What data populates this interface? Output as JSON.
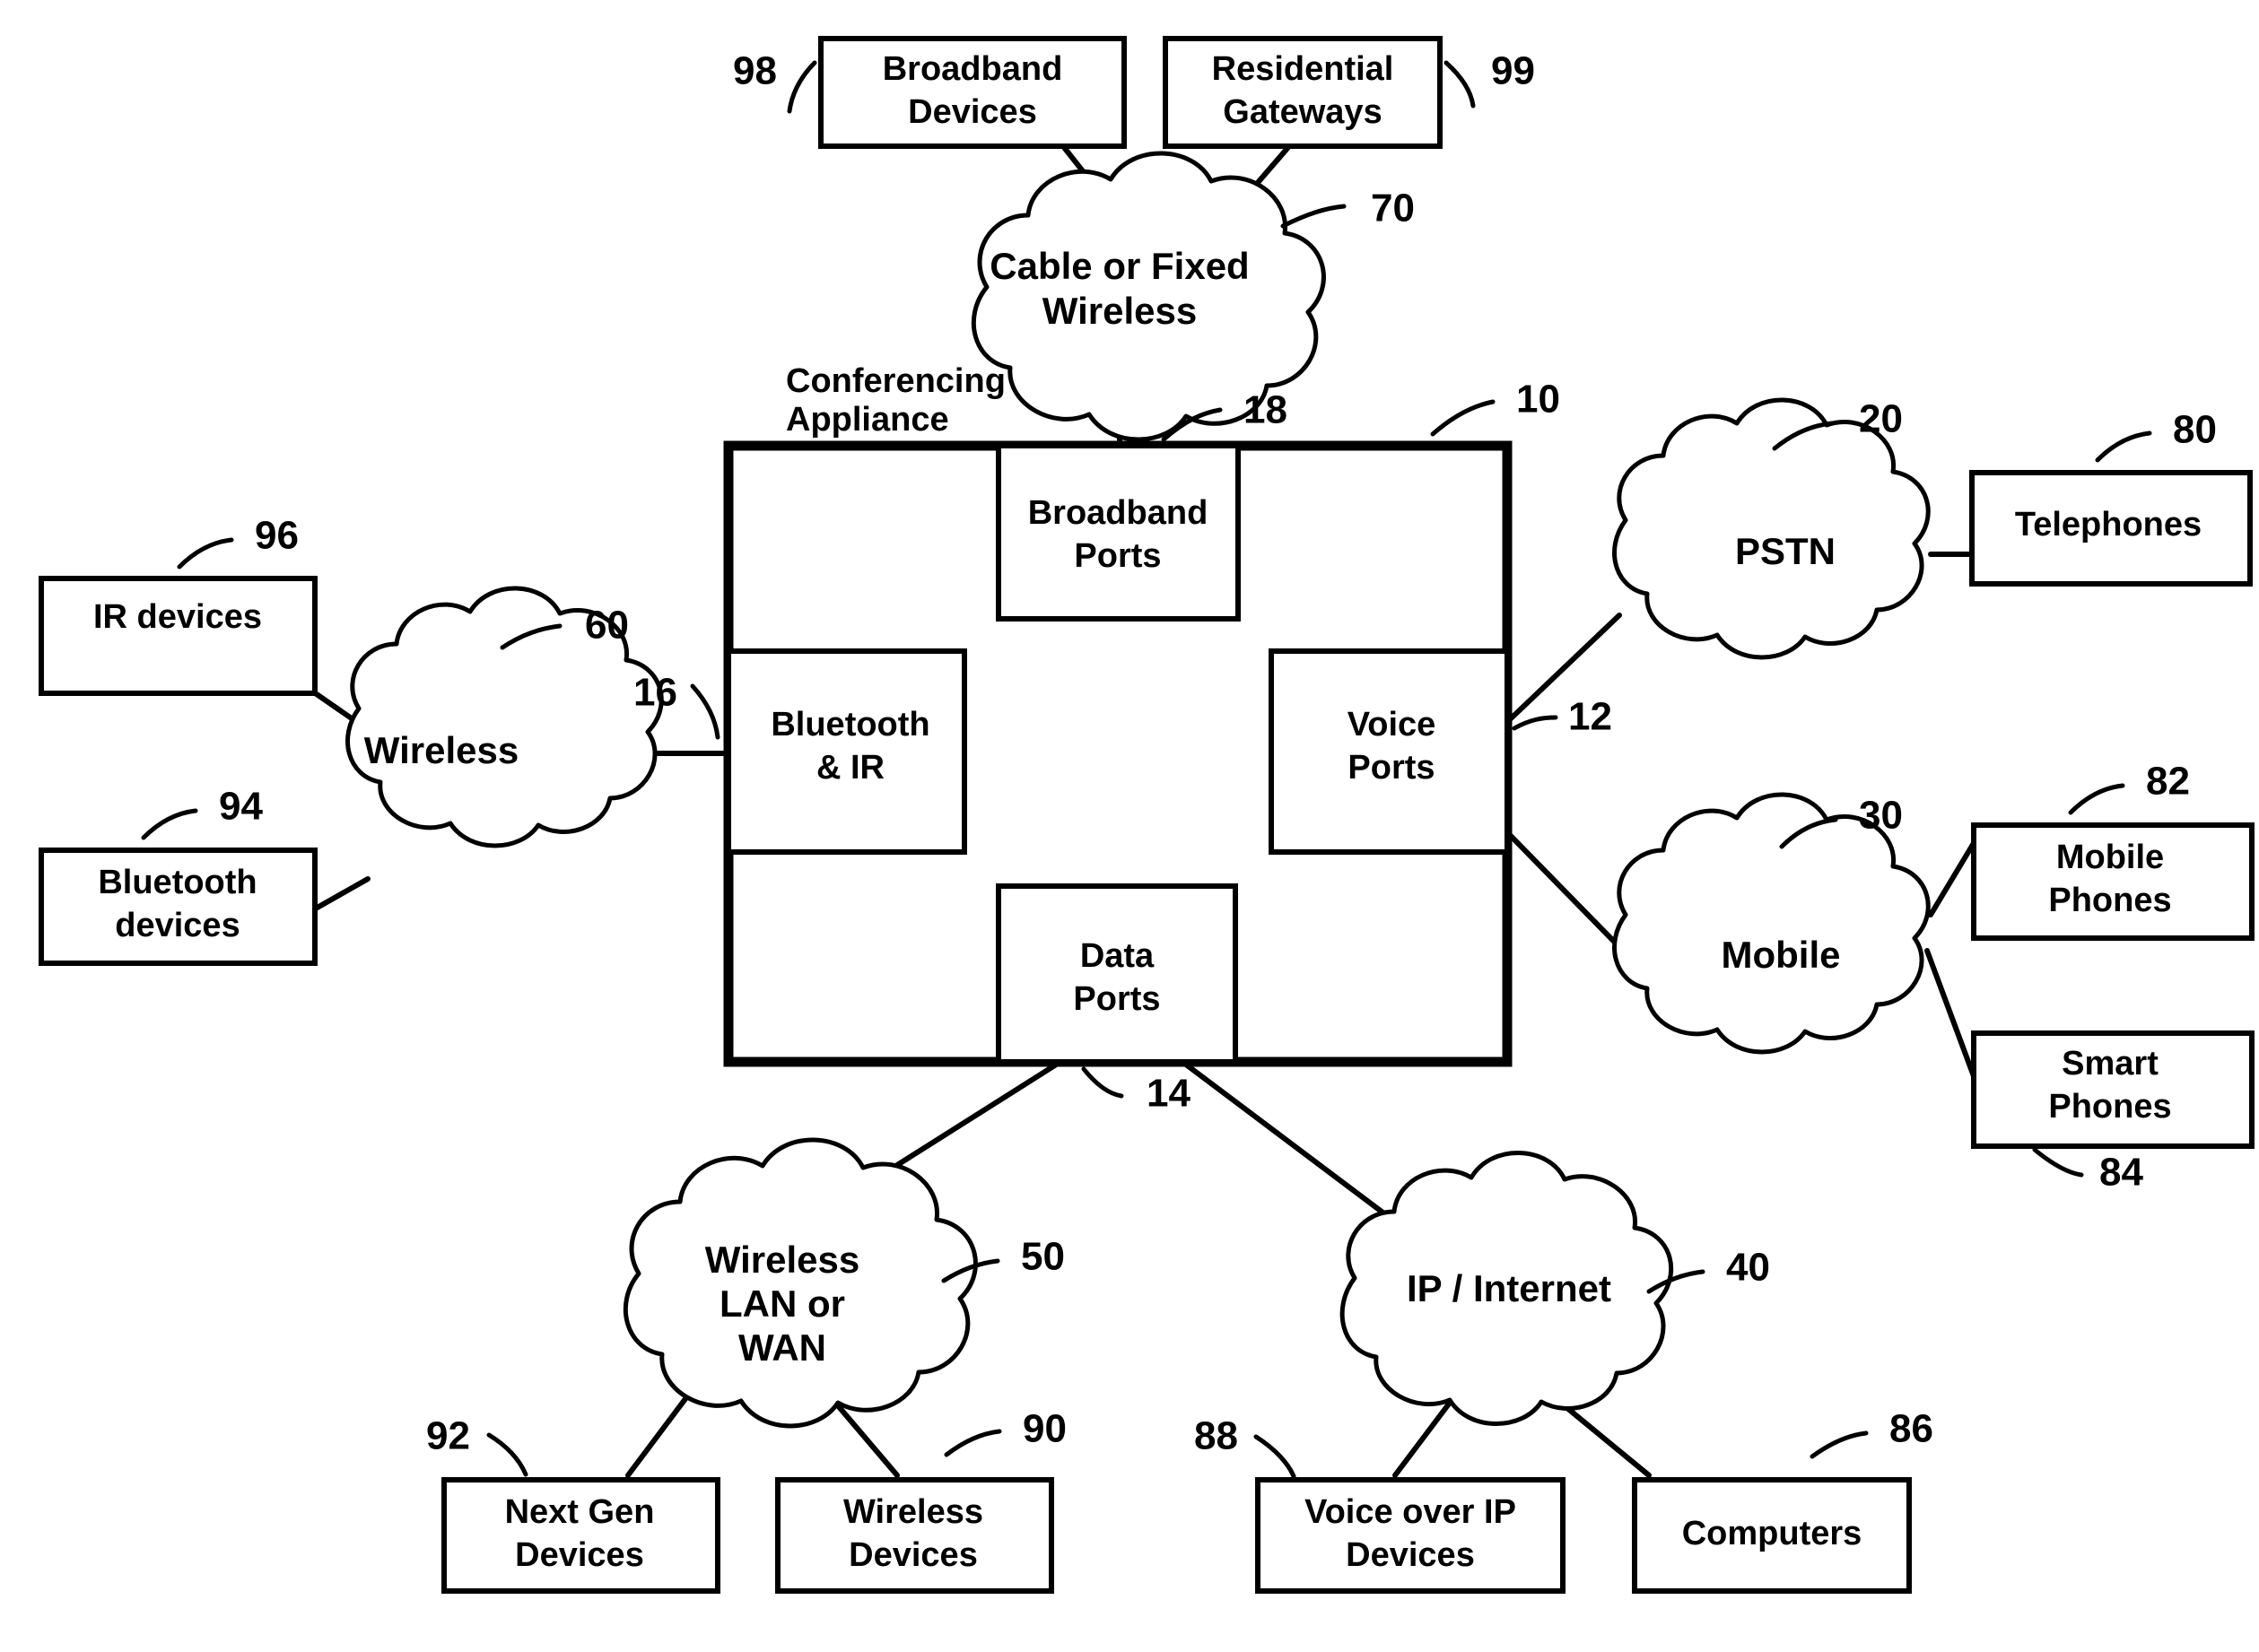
{
  "figure": {
    "title": "Conferencing Appliance Network Diagram",
    "caption_appliance": "Conferencing Appliance"
  },
  "appliance": {
    "ref": "10",
    "ports": [
      {
        "id": "broadband",
        "label": "Broadband\nPorts",
        "line1": "Broadband",
        "line2": "Ports",
        "ref": "18"
      },
      {
        "id": "bluetooth_ir",
        "label": "Bluetooth\n& IR",
        "line1": "Bluetooth",
        "line2": "& IR",
        "ref": "16"
      },
      {
        "id": "voice",
        "label": "Voice\nPorts",
        "line1": "Voice",
        "line2": "Ports",
        "ref": "12"
      },
      {
        "id": "data",
        "label": "Data\nPorts",
        "line1": "Data",
        "line2": "Ports",
        "ref": "14"
      }
    ]
  },
  "clouds": [
    {
      "id": "cable_fixed_wireless",
      "line1": "Cable or Fixed",
      "line2": "Wireless",
      "line3": "",
      "ref": "70"
    },
    {
      "id": "wireless",
      "line1": "Wireless",
      "line2": "",
      "line3": "",
      "ref": "60"
    },
    {
      "id": "pstn",
      "line1": "PSTN",
      "line2": "",
      "line3": "",
      "ref": "20"
    },
    {
      "id": "mobile",
      "line1": "Mobile",
      "line2": "",
      "line3": "",
      "ref": "30"
    },
    {
      "id": "wireless_lan_wan",
      "line1": "Wireless",
      "line2": "LAN or",
      "line3": "WAN",
      "ref": "50"
    },
    {
      "id": "ip_internet",
      "line1": "IP / Internet",
      "line2": "",
      "line3": "",
      "ref": "40"
    }
  ],
  "devices": [
    {
      "id": "broadband_devices",
      "line1": "Broadband",
      "line2": "Devices",
      "ref": "98"
    },
    {
      "id": "residential_gateways",
      "line1": "Residential",
      "line2": "Gateways",
      "ref": "99"
    },
    {
      "id": "ir_devices",
      "line1": "IR devices",
      "line2": "",
      "ref": "96"
    },
    {
      "id": "bluetooth_devices",
      "line1": "Bluetooth",
      "line2": "devices",
      "ref": "94"
    },
    {
      "id": "telephones",
      "line1": "Telephones",
      "line2": "",
      "ref": "80"
    },
    {
      "id": "mobile_phones",
      "line1": "Mobile",
      "line2": "Phones",
      "ref": "82"
    },
    {
      "id": "smart_phones",
      "line1": "Smart",
      "line2": "Phones",
      "ref": "84"
    },
    {
      "id": "next_gen_devices",
      "line1": "Next Gen",
      "line2": "Devices",
      "ref": "92"
    },
    {
      "id": "wireless_devices",
      "line1": "Wireless",
      "line2": "Devices",
      "ref": "90"
    },
    {
      "id": "voice_over_ip_devices",
      "line1": "Voice over IP",
      "line2": "Devices",
      "ref": "88"
    },
    {
      "id": "computers",
      "line1": "Computers",
      "line2": "",
      "ref": "86"
    }
  ],
  "colors": {
    "ink": "#000000",
    "paper": "#ffffff"
  }
}
